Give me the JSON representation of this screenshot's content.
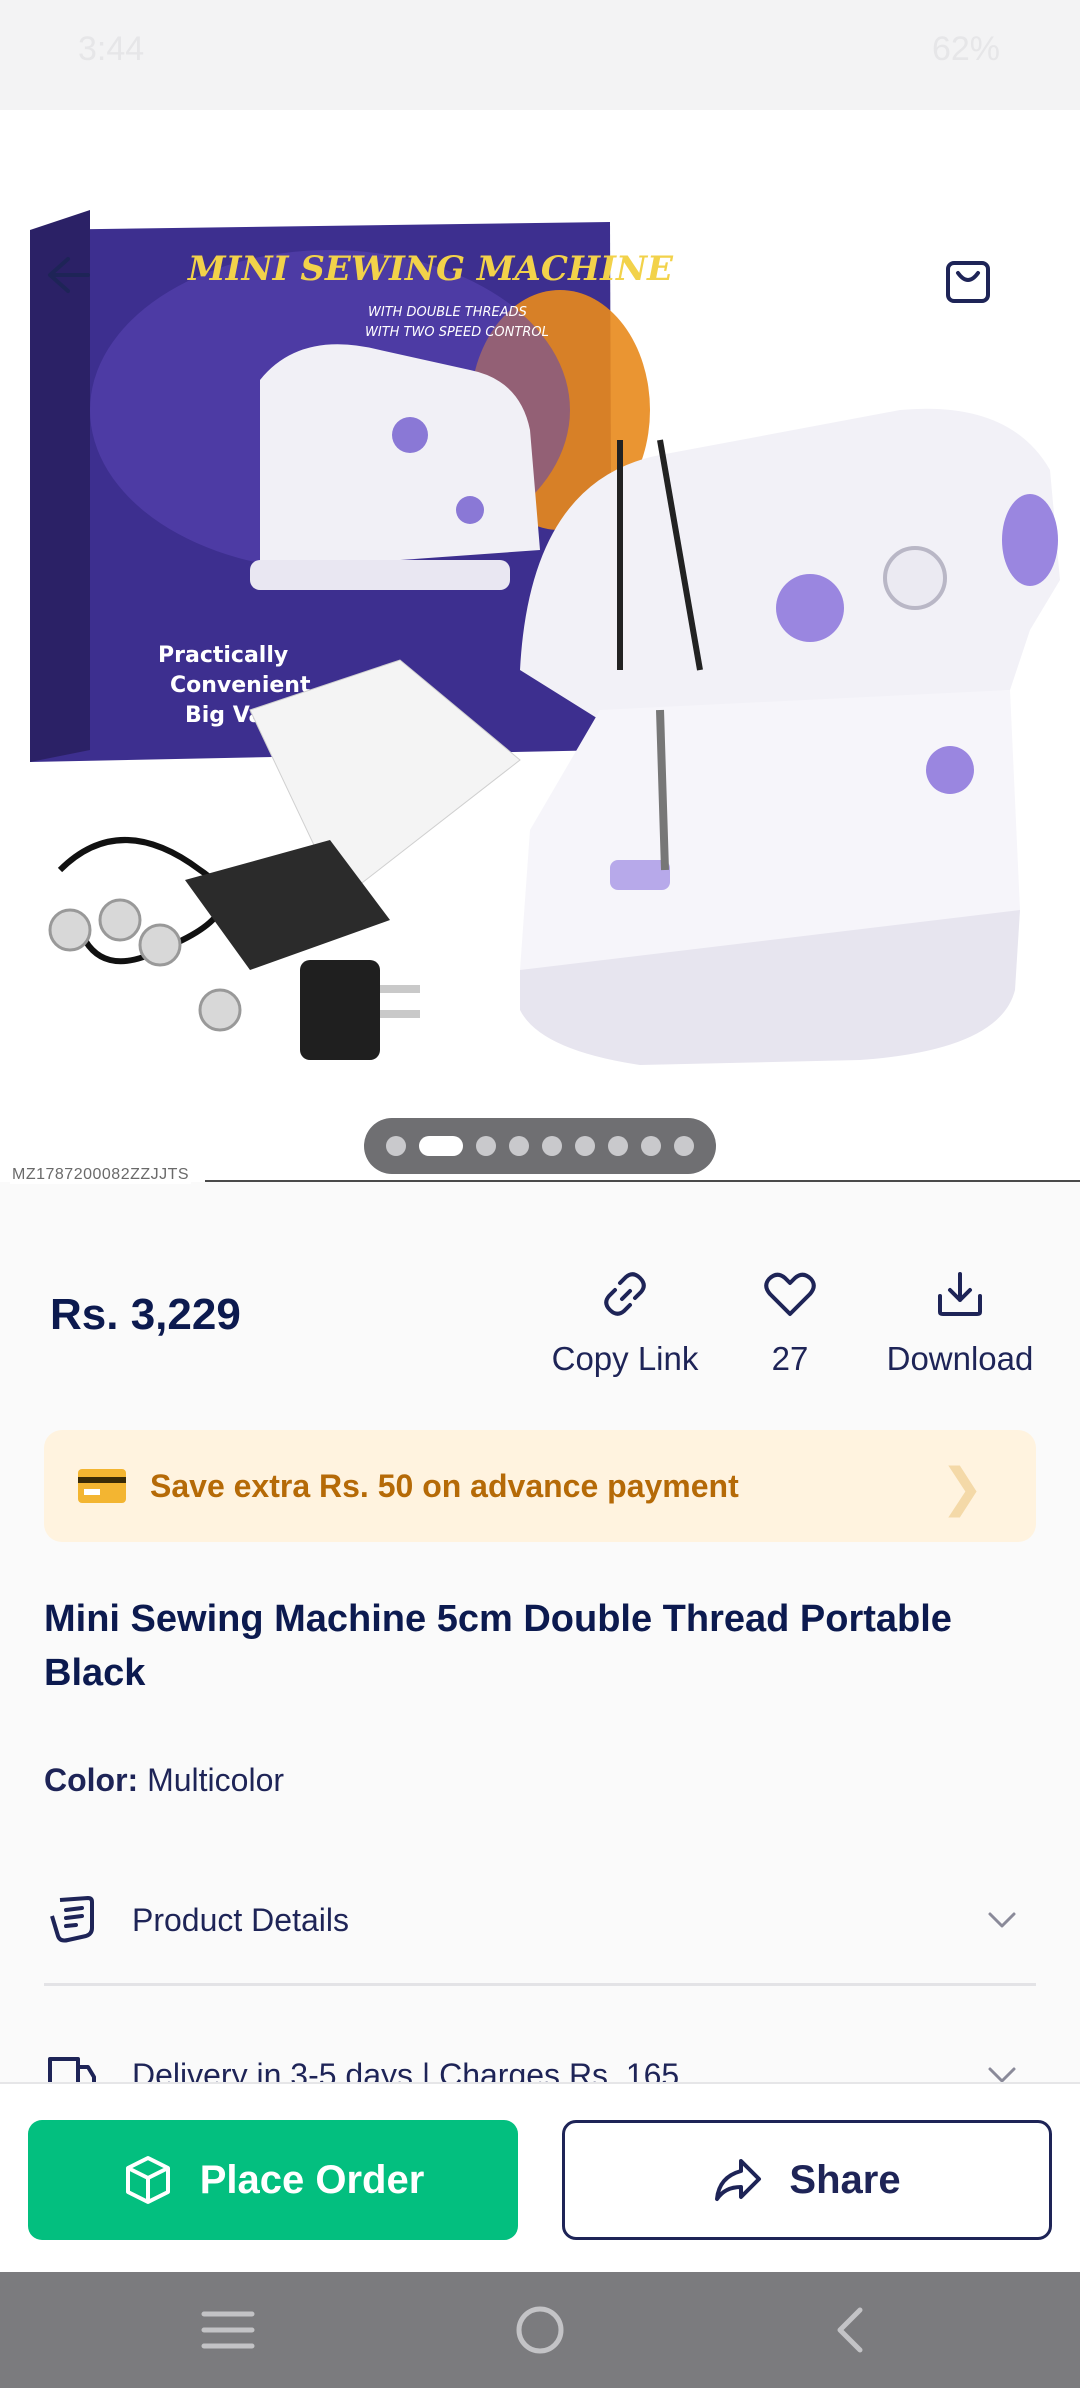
{
  "status_bar": {
    "time": "3:44",
    "battery": "62%"
  },
  "product_image": {
    "sku": "MZ1787200082ZZJJTS",
    "box_title": "MINI SEWING MACHINE",
    "box_sub1": "WITH DOUBLE THREADS",
    "box_sub2": "WITH TWO SPEED CONTROL",
    "box_tag1": "Practically",
    "box_tag2": "Convenient",
    "box_tag3": "Big Val",
    "slides_total": 9,
    "slide_active": 2
  },
  "price": "Rs. 3,229",
  "actions": {
    "copy_link": "Copy Link",
    "likes": "27",
    "download": "Download"
  },
  "offer": {
    "text": "Save extra Rs. 50 on advance payment"
  },
  "title": "Mini Sewing Machine 5cm Double Thread Portable Black",
  "color": {
    "label": "Color:",
    "value": "Multicolor"
  },
  "sections": {
    "details": "Product Details",
    "delivery": "Delivery in 3-5 days | Charges Rs. 165"
  },
  "buttons": {
    "place_order": "Place Order",
    "share": "Share"
  },
  "colors": {
    "brand_navy": "#0c1a4f",
    "accent_green": "#03bf7f",
    "offer_bg": "#fff3df",
    "offer_text": "#b56a07"
  }
}
